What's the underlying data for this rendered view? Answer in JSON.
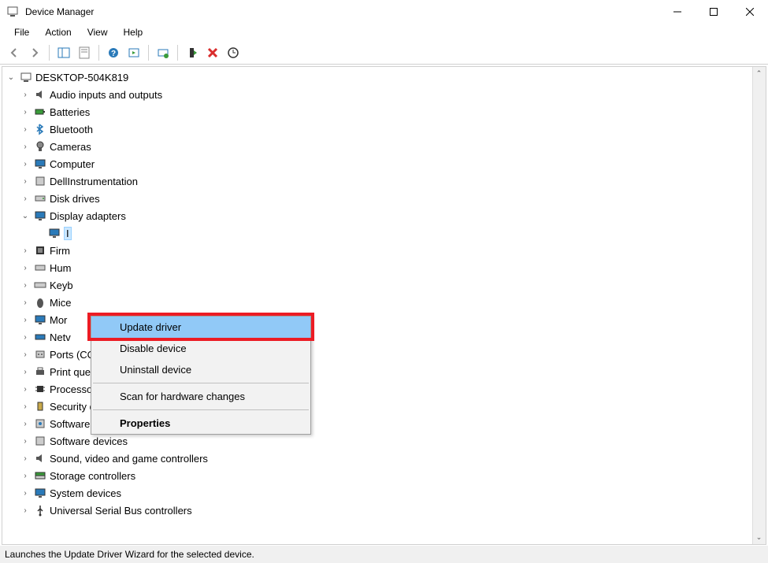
{
  "window": {
    "title": "Device Manager"
  },
  "menubar": {
    "file": "File",
    "action": "Action",
    "view": "View",
    "help": "Help"
  },
  "tree": {
    "root": "DESKTOP-504K819",
    "categories": [
      "Audio inputs and outputs",
      "Batteries",
      "Bluetooth",
      "Cameras",
      "Computer",
      "DellInstrumentation",
      "Disk drives",
      "Display adapters",
      "Firmware",
      "Human Interface Devices",
      "Keyboards",
      "Mice and other pointing devices",
      "Monitors",
      "Network adapters",
      "Ports (COM & LPT)",
      "Print queues",
      "Processors",
      "Security devices",
      "Software components",
      "Software devices",
      "Sound, video and game controllers",
      "Storage controllers",
      "System devices",
      "Universal Serial Bus controllers"
    ],
    "truncated": {
      "display_child": "I",
      "firmware": "Firm",
      "hid": "Hum",
      "keyboards": "Keyb",
      "mice": "Mice",
      "monitors": "Mor",
      "network": "Netv"
    }
  },
  "context_menu": {
    "update_driver": "Update driver",
    "disable_device": "Disable device",
    "uninstall_device": "Uninstall device",
    "scan_hardware": "Scan for hardware changes",
    "properties": "Properties"
  },
  "statusbar": {
    "text": "Launches the Update Driver Wizard for the selected device."
  }
}
